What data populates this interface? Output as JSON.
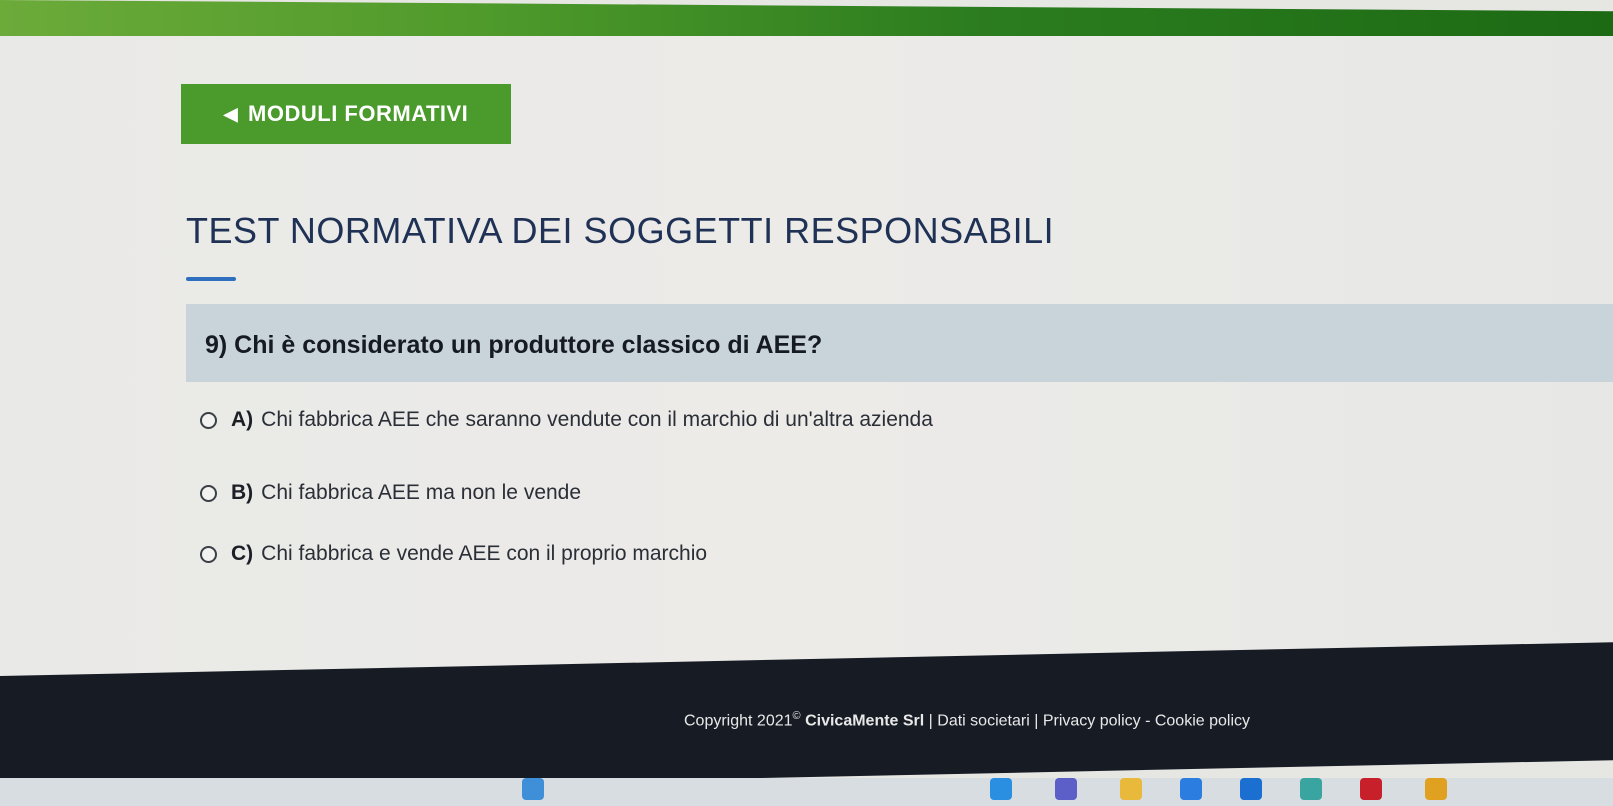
{
  "nav": {
    "back_arrow": "◀",
    "back_label": "MODULI FORMATIVI"
  },
  "page": {
    "title": "TEST NORMATIVA DEI SOGGETTI RESPONSABILI"
  },
  "question": {
    "text": "9) Chi è considerato un produttore classico di AEE?",
    "options": [
      {
        "letter": "A)",
        "text": "Chi fabbrica AEE che saranno vendute con il marchio di un'altra azienda"
      },
      {
        "letter": "B)",
        "text": "Chi fabbrica AEE ma non le vende"
      },
      {
        "letter": "C)",
        "text": "Chi fabbrica e vende AEE con il proprio marchio"
      }
    ]
  },
  "footer": {
    "copyright": "Copyright 2021",
    "symbol": "©",
    "company": " CivicaMente Srl",
    "sep1": " | ",
    "link_dati": "Dati societari",
    "sep2": " | ",
    "link_privacy": "Privacy policy",
    "sep3": " - ",
    "link_cookie": "Cookie policy"
  },
  "colors": {
    "brand_green": "#4a9a2c",
    "title_blue": "#1f3155",
    "accent_blue": "#2e6fc0",
    "footer_dark": "#161b24"
  },
  "taskbar": {
    "icons": [
      "widgets-icon",
      "edge-browser-icon",
      "teams-icon",
      "file-explorer-icon",
      "store-icon",
      "mail-icon",
      "photos-icon",
      "mcafee-icon",
      "chrome-icon"
    ],
    "icon_colors": [
      "#3f8fd8",
      "#2a8fe0",
      "#5b5fc7",
      "#e8b93a",
      "#2b7de0",
      "#1a6fd1",
      "#3aa4a0",
      "#c8202a",
      "#e0a020"
    ]
  }
}
